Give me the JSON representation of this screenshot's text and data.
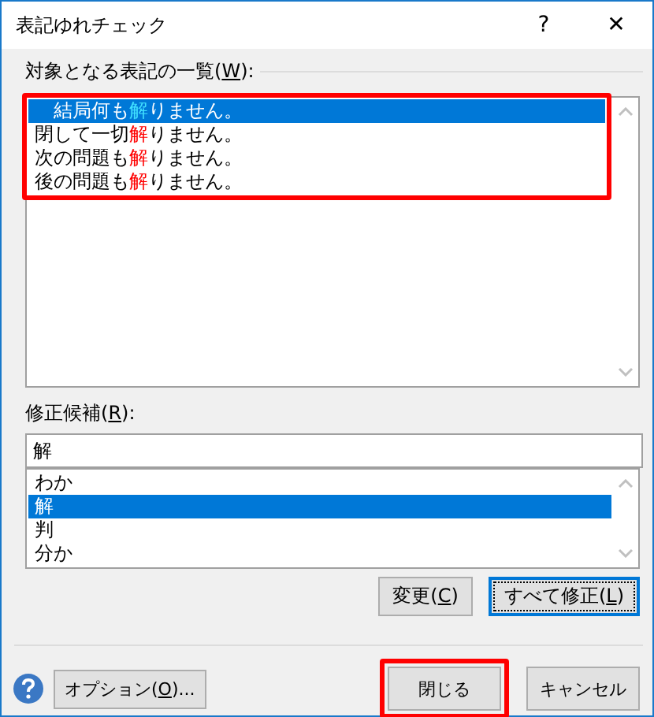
{
  "window": {
    "title": "表記ゆれチェック",
    "help_glyph": "?",
    "close_glyph": "✕"
  },
  "targets": {
    "label_parts": [
      "対象となる表記の一覧(",
      "W",
      "):"
    ],
    "annotated": true,
    "items": [
      {
        "prefix": "結局何も",
        "match": "解",
        "suffix": "りません。",
        "selected": true
      },
      {
        "prefix": "閉して一切",
        "match": "解",
        "suffix": "りません。",
        "selected": false
      },
      {
        "prefix": "次の問題も",
        "match": "解",
        "suffix": "りません。",
        "selected": false
      },
      {
        "prefix": "後の問題も",
        "match": "解",
        "suffix": "りません。",
        "selected": false
      }
    ]
  },
  "candidates": {
    "label_parts": [
      "修正候補(",
      "R",
      "):"
    ],
    "value": "解",
    "items": [
      {
        "text": "わか",
        "selected": false
      },
      {
        "text": "解",
        "selected": true
      },
      {
        "text": "判",
        "selected": false
      },
      {
        "text": "分か",
        "selected": false
      }
    ]
  },
  "action_buttons": [
    {
      "label_parts": [
        "変更(",
        "C",
        ")"
      ],
      "default": false
    },
    {
      "label_parts": [
        "すべて修正(",
        "L",
        ")"
      ],
      "default": true
    }
  ],
  "footer": {
    "options_button": {
      "label_parts": [
        "オプション(",
        "O",
        ")..."
      ]
    },
    "buttons": [
      {
        "label": "閉じる",
        "annotated": true
      },
      {
        "label": "キャンセル",
        "annotated": false
      }
    ]
  }
}
